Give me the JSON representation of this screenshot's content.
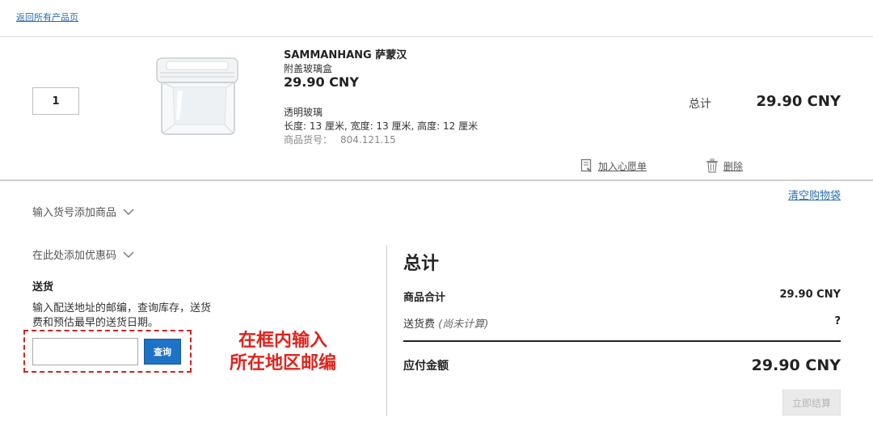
{
  "nav": {
    "back_link": "返回所有产品页"
  },
  "cart_item": {
    "quantity": "1",
    "name": "SAMMANHANG 萨蒙汉",
    "description": "附盖玻璃盒",
    "price": "29.90 CNY",
    "material": "透明玻璃",
    "dimensions": "长度: 13 厘米, 宽度: 13 厘米, 高度: 12 厘米",
    "article_label": "商品货号：",
    "article_number": "804.121.15",
    "total_label": "总计",
    "total_value": "29.90 CNY",
    "wishlist_label": "加入心愿单",
    "delete_label": "删除"
  },
  "cart_actions": {
    "clear_bag": "清空购物袋"
  },
  "left_panel": {
    "add_by_article": "输入货号添加商品",
    "add_coupon": "在此处添加优惠码",
    "delivery_title": "送货",
    "delivery_text": "输入配送地址的邮编，查询库存，送货费和预估最早的送货日期。",
    "zip_placeholder": "",
    "zip_button": "查询",
    "annotation_line1": "在框内输入",
    "annotation_line2": "所在地区邮编"
  },
  "summary": {
    "title": "总计",
    "items_label": "商品合计",
    "items_value": "29.90 CNY",
    "shipping_label": "送货费",
    "shipping_note": "(尚未计算)",
    "shipping_value": "?",
    "pay_label": "应付金额",
    "pay_value": "29.90 CNY",
    "checkout_button": "立即结算"
  },
  "colors": {
    "link": "#2a6cb0",
    "primary_button": "#1f73c6",
    "annotation": "#e0231d",
    "disabled_button": "#eaeaea"
  },
  "icons": [
    "product-glass-box-image",
    "wishlist-icon",
    "trash-icon",
    "chevron-down-icon"
  ]
}
